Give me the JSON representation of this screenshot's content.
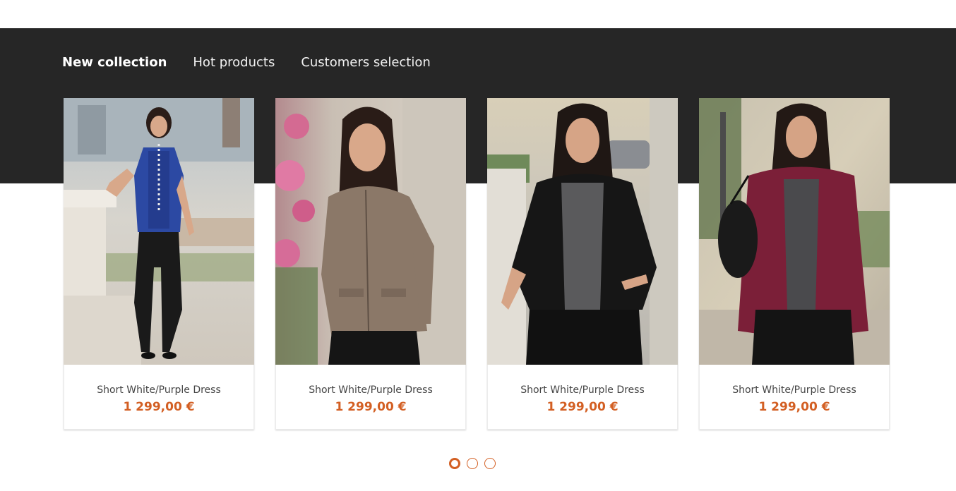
{
  "tabs": [
    {
      "label": "New collection",
      "active": true
    },
    {
      "label": "Hot products",
      "active": false
    },
    {
      "label": "Customers selection",
      "active": false
    }
  ],
  "products": [
    {
      "title": "Short White/Purple Dress",
      "price": "1 299,00 €",
      "image": "woman-blue-lace-top-photo"
    },
    {
      "title": "Short White/Purple Dress",
      "price": "1 299,00 €",
      "image": "woman-taupe-leather-jacket-photo"
    },
    {
      "title": "Short White/Purple Dress",
      "price": "1 299,00 €",
      "image": "woman-black-blazer-photo"
    },
    {
      "title": "Short White/Purple Dress",
      "price": "1 299,00 €",
      "image": "woman-burgundy-leather-jacket-photo"
    }
  ],
  "pagination": {
    "pages": 3,
    "current": 1
  },
  "colors": {
    "accent": "#d35f23",
    "band": "#262626",
    "text": "#444444"
  }
}
